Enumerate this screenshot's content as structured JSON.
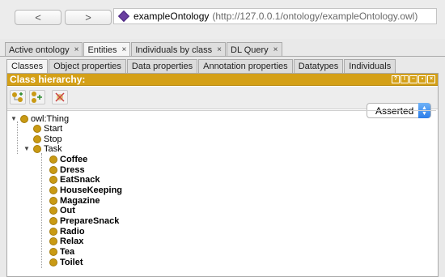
{
  "nav": {
    "back_label": "<",
    "forward_label": ">"
  },
  "address": {
    "ontology_name": "exampleOntology",
    "iri": "(http://127.0.0.1/ontology/exampleOntology.owl)"
  },
  "tabs": [
    {
      "label": "Active ontology",
      "close": "×"
    },
    {
      "label": "Entities",
      "close": "×"
    },
    {
      "label": "Individuals by class",
      "close": "×"
    },
    {
      "label": "DL Query",
      "close": "×"
    }
  ],
  "subtabs": [
    "Classes",
    "Object properties",
    "Data properties",
    "Annotation properties",
    "Datatypes",
    "Individuals"
  ],
  "panel": {
    "title": "Class hierarchy:",
    "header_buttons": [
      "?",
      "I",
      "–",
      "▪",
      "×"
    ],
    "mode": "Asserted"
  },
  "tree": {
    "root": "owl:Thing",
    "top_children": [
      "Start",
      "Stop",
      "Task"
    ],
    "task_children": [
      "Coffee",
      "Dress",
      "EatSnack",
      "HouseKeeping",
      "Magazine",
      "Out",
      "PrepareSnack",
      "Radio",
      "Relax",
      "Tea",
      "Toilet"
    ]
  },
  "colors": {
    "accent": "#d4a017",
    "class_dot": "#c99a14",
    "select_arrow": "#2b7de9"
  }
}
